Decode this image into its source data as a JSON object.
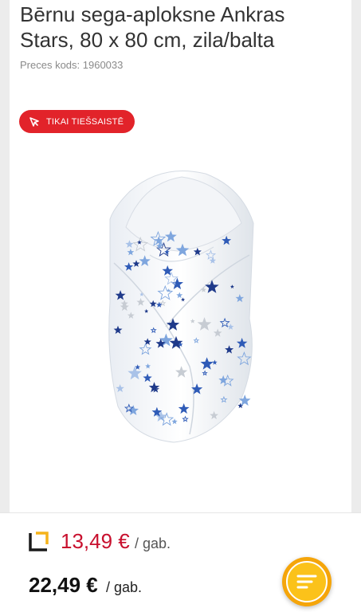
{
  "product": {
    "title": "Bērnu sega-aploksne Ankras Stars, 80 x 80 cm, zila/balta",
    "sku": "Preces kods: 1960033",
    "badge": "TIKAI TIEŠSAISTĒ",
    "image_icon": "swaddle-blanket-image"
  },
  "pricing": {
    "promo_price": "13,49 €",
    "promo_unit": "/ gab.",
    "regular_price": "22,49 €",
    "regular_unit": "/ gab."
  },
  "colors": {
    "badge": "#e2232a",
    "promo_price": "#c8102e",
    "chat_button": "#fbc21a",
    "loyalty_accent": "#f5b31a",
    "loyalty_dark": "#1a1a1a"
  }
}
